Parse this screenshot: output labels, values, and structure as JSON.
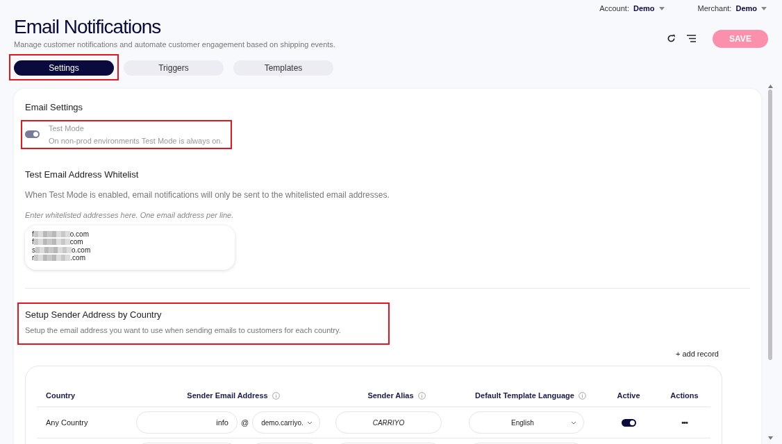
{
  "top_bar": {
    "account": {
      "label": "Account:",
      "value": "Demo"
    },
    "merchant": {
      "label": "Merchant:",
      "value": "Demo"
    }
  },
  "header": {
    "title": "Email Notifications",
    "subtitle": "Manage customer notifications and automate customer engagement based on shipping events.",
    "save_button": {
      "label": "SAVE",
      "disabled": true
    }
  },
  "tabs": [
    {
      "label": "Settings",
      "selected": true,
      "highlighted": true
    },
    {
      "label": "Triggers",
      "selected": false,
      "highlighted": false
    },
    {
      "label": "Templates",
      "selected": false,
      "highlighted": false
    }
  ],
  "email_settings": {
    "title": "Email Settings",
    "test_mode": {
      "label": "Test Mode",
      "hint": "On non-prod environments Test Mode is always on.",
      "on": true,
      "disabled": true,
      "highlighted": true
    }
  },
  "whitelist": {
    "title": "Test Email Address Whitelist",
    "description": "When Test Mode is enabled, email notifications will only be sent to the whitelisted email addresses.",
    "instruction": "Enter whitelisted addresses here. One email address per line.",
    "addresses": [
      {
        "start": "f",
        "end": "o.com"
      },
      {
        "start": "f",
        "end": "com"
      },
      {
        "start": "s",
        "end": "o.com"
      },
      {
        "start": "r",
        "end": ".com"
      }
    ]
  },
  "sender_section": {
    "title": "Setup Sender Address by Country",
    "description": "Setup the email address you want to use when sending emails to customers for each country.",
    "highlighted": true,
    "add_record": "+ add record"
  },
  "table": {
    "columns": [
      {
        "label": "Country",
        "info": false
      },
      {
        "label": "Sender Email Address",
        "info": true
      },
      {
        "label": "Sender Alias",
        "info": true
      },
      {
        "label": "Default Template Language",
        "info": true
      },
      {
        "label": "Active",
        "info": false
      },
      {
        "label": "Actions",
        "info": false
      }
    ],
    "rows": [
      {
        "kind": "filled",
        "country": "Any Country",
        "local_part": "info",
        "at": "@",
        "domain": "demo.carriyo.",
        "alias": "CARRIYO",
        "language": "English",
        "active": true,
        "actions": "•••"
      },
      {
        "kind": "blank"
      }
    ]
  }
}
